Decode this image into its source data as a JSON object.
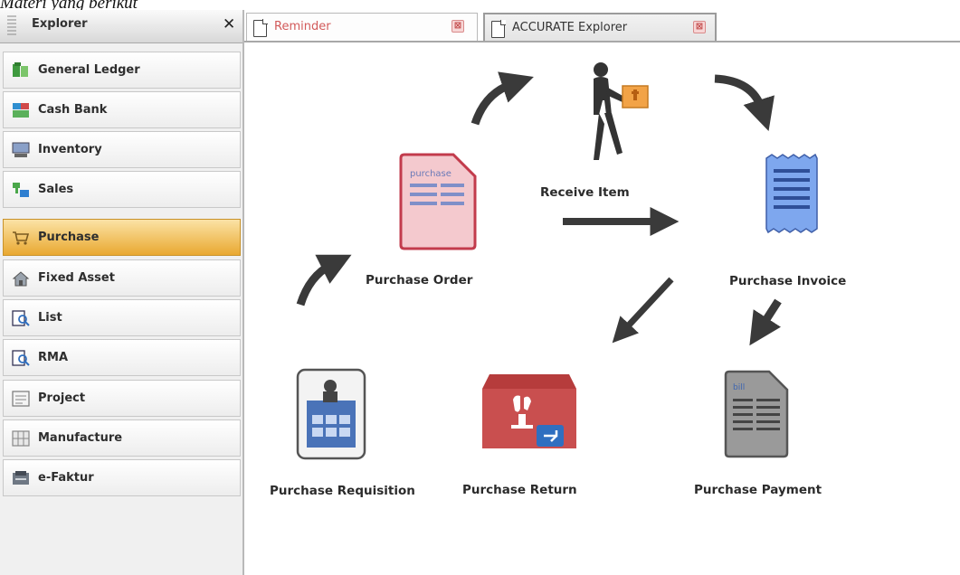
{
  "caption": "Materi yang berikut",
  "sidebar": {
    "title": "Explorer",
    "close_glyph": "✕",
    "items": [
      {
        "label": "General Ledger",
        "icon": "general-ledger-icon"
      },
      {
        "label": "Cash Bank",
        "icon": "cash-bank-icon"
      },
      {
        "label": "Inventory",
        "icon": "inventory-icon"
      },
      {
        "label": "Sales",
        "icon": "sales-icon"
      },
      {
        "label": "Purchase",
        "icon": "cart-icon",
        "active": true
      },
      {
        "label": "Fixed Asset",
        "icon": "house-icon"
      },
      {
        "label": "List",
        "icon": "magnifier-doc-icon"
      },
      {
        "label": "RMA",
        "icon": "magnifier-doc-icon"
      },
      {
        "label": "Project",
        "icon": "project-icon"
      },
      {
        "label": "Manufacture",
        "icon": "manufacture-icon"
      },
      {
        "label": "e-Faktur",
        "icon": "e-faktur-icon"
      }
    ]
  },
  "tabs": [
    {
      "label": "Reminder",
      "close": "⊠"
    },
    {
      "label": "ACCURATE Explorer",
      "close": "⊠",
      "active": true
    }
  ],
  "flow": {
    "receive_item": "Receive Item",
    "purchase_order": "Purchase Order",
    "purchase_order_doc_text": "purchase",
    "purchase_invoice": "Purchase Invoice",
    "purchase_requisition": "Purchase Requisition",
    "purchase_return": "Purchase Return",
    "purchase_payment": "Purchase Payment",
    "purchase_payment_doc_text": "bill"
  },
  "colors": {
    "active_item": "#e9a830",
    "arrow": "#3a3a3a",
    "purchase_order_doc": "#f4c9ce",
    "invoice_doc": "#7ea7ee",
    "return_box": "#c94f4f"
  }
}
